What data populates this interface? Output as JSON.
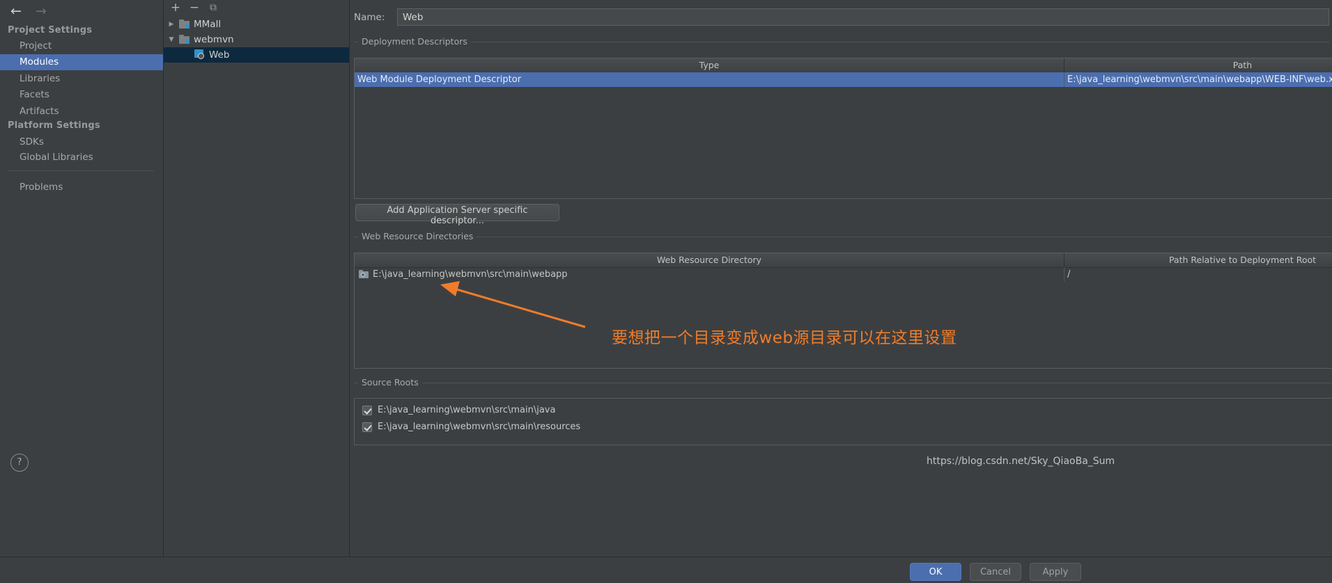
{
  "sidebar": {
    "back_icon": "arrow-left-icon",
    "forward_icon": "arrow-right-icon",
    "groups": [
      {
        "label": "Project Settings"
      },
      {
        "label": "Platform Settings"
      }
    ],
    "project_items": [
      {
        "label": "Project",
        "selected": false
      },
      {
        "label": "Modules",
        "selected": true
      },
      {
        "label": "Libraries",
        "selected": false
      },
      {
        "label": "Facets",
        "selected": false
      },
      {
        "label": "Artifacts",
        "selected": false
      }
    ],
    "platform_items": [
      {
        "label": "SDKs",
        "selected": false
      },
      {
        "label": "Global Libraries",
        "selected": false
      }
    ],
    "problems_label": "Problems",
    "help_label": "?"
  },
  "tree": {
    "toolbar": {
      "add_label": "+",
      "remove_label": "−",
      "copy_label": "⧉"
    },
    "nodes": [
      {
        "label": "MMall",
        "twisty": "▶",
        "icon": "module-folder-icon",
        "indent": 0,
        "selected": false
      },
      {
        "label": "webmvn",
        "twisty": "▼",
        "icon": "module-folder-icon",
        "indent": 0,
        "selected": false
      },
      {
        "label": "Web",
        "twisty": "",
        "icon": "web-facet-icon",
        "indent": 1,
        "selected": true
      }
    ]
  },
  "form": {
    "name_label": "Name:",
    "name_value": "Web",
    "deployment": {
      "title": "Deployment Descriptors",
      "columns": [
        "Type",
        "Path"
      ],
      "rows": [
        {
          "type": "Web Module Deployment Descriptor",
          "path": "E:\\java_learning\\webmvn\\src\\main\\webapp\\WEB-INF\\web.xml",
          "selected": true
        }
      ],
      "tools": [
        {
          "icon": "plus-icon",
          "label": "+"
        },
        {
          "icon": "minus-icon",
          "label": "−"
        },
        {
          "icon": "pencil-icon",
          "label": "✎"
        }
      ],
      "add_descriptor_button": "Add Application Server specific descriptor..."
    },
    "web_resources": {
      "title": "Web Resource Directories",
      "columns": [
        "Web Resource Directory",
        "Path Relative to Deployment Root"
      ],
      "rows": [
        {
          "directory": "E:\\java_learning\\webmvn\\src\\main\\webapp",
          "relative_path": "/",
          "icon": "directory-icon"
        }
      ],
      "tools": [
        {
          "icon": "plus-icon",
          "label": "+"
        },
        {
          "icon": "minus-icon",
          "label": "−"
        },
        {
          "icon": "pencil-icon",
          "label": "✎"
        },
        {
          "icon": "question-icon",
          "label": "?"
        }
      ]
    },
    "source_roots": {
      "title": "Source Roots",
      "items": [
        {
          "label": "E:\\java_learning\\webmvn\\src\\main\\java",
          "checked": true
        },
        {
          "label": "E:\\java_learning\\webmvn\\src\\main\\resources",
          "checked": true
        }
      ]
    }
  },
  "footer": {
    "ok_label": "OK",
    "cancel_label": "Cancel",
    "apply_label": "Apply"
  },
  "annotation": {
    "text": "要想把一个目录变成web源目录可以在这里设置",
    "color": "#f07c2b",
    "arrow_icon": "arrow-annotation-icon"
  },
  "watermark": {
    "text": "https://blog.csdn.net/Sky_QiaoBa_Sum"
  },
  "colors": {
    "accent": "#4b6eaf",
    "background": "#3c3f41",
    "annotation": "#f07c2b",
    "tree_selection": "#0d293e"
  }
}
